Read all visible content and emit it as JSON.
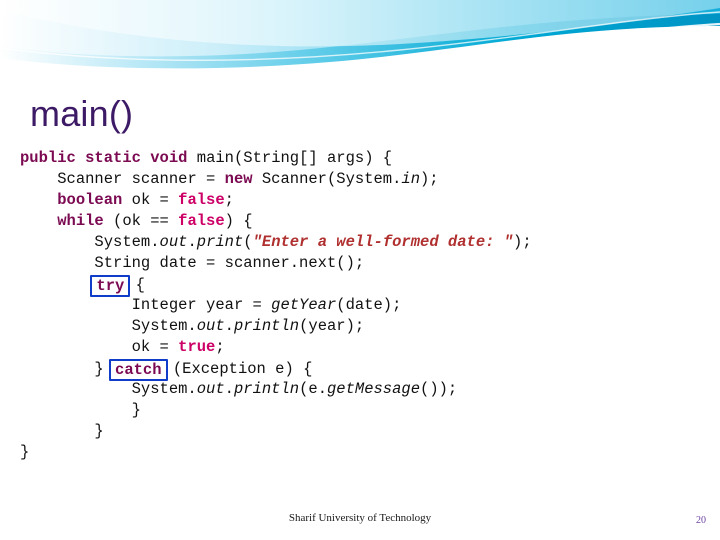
{
  "slide": {
    "title": "main()",
    "footer": "Sharif University of Technology",
    "page_number": "20",
    "accent_color": "#3d1a66",
    "banner_colors": [
      "#00b0d8",
      "#7ad8ef",
      "#c9eff9",
      "#ffffff"
    ]
  },
  "code": {
    "lines": [
      {
        "indent": 0,
        "tokens": [
          {
            "t": "public",
            "c": "kw"
          },
          {
            "t": " ",
            "c": "plain"
          },
          {
            "t": "static",
            "c": "kw"
          },
          {
            "t": " ",
            "c": "plain"
          },
          {
            "t": "void",
            "c": "kw"
          },
          {
            "t": " ",
            "c": "plain"
          },
          {
            "t": "main(String[] args) {",
            "c": "plain"
          }
        ]
      },
      {
        "indent": 1,
        "tokens": [
          {
            "t": "Scanner scanner = ",
            "c": "plain"
          },
          {
            "t": "new",
            "c": "kw"
          },
          {
            "t": " Scanner(System.",
            "c": "plain"
          },
          {
            "t": "in",
            "c": "ital"
          },
          {
            "t": ");",
            "c": "plain"
          }
        ]
      },
      {
        "indent": 1,
        "tokens": [
          {
            "t": "boolean",
            "c": "kw"
          },
          {
            "t": " ok = ",
            "c": "plain"
          },
          {
            "t": "false",
            "c": "kw2"
          },
          {
            "t": ";",
            "c": "plain"
          }
        ]
      },
      {
        "indent": 1,
        "tokens": [
          {
            "t": "while",
            "c": "kw"
          },
          {
            "t": " (ok == ",
            "c": "plain"
          },
          {
            "t": "false",
            "c": "kw2"
          },
          {
            "t": ") {",
            "c": "plain"
          }
        ]
      },
      {
        "indent": 2,
        "tokens": [
          {
            "t": "System.",
            "c": "plain"
          },
          {
            "t": "out",
            "c": "ital"
          },
          {
            "t": ".",
            "c": "plain"
          },
          {
            "t": "print",
            "c": "meth"
          },
          {
            "t": "(",
            "c": "plain"
          },
          {
            "t": "\"Enter a well-formed date: \"",
            "c": "str"
          },
          {
            "t": ");",
            "c": "plain"
          }
        ]
      },
      {
        "indent": 2,
        "tokens": [
          {
            "t": "String date = scanner.next();",
            "c": "plain"
          }
        ]
      },
      {
        "indent": 2,
        "tokens": [
          {
            "t": "try",
            "c": "boxed-kw"
          },
          {
            "t": " {",
            "c": "plain"
          }
        ]
      },
      {
        "indent": 3,
        "tokens": [
          {
            "t": "Integer year = ",
            "c": "plain"
          },
          {
            "t": "getYear",
            "c": "meth"
          },
          {
            "t": "(date);",
            "c": "plain"
          }
        ]
      },
      {
        "indent": 3,
        "tokens": [
          {
            "t": "System.",
            "c": "plain"
          },
          {
            "t": "out",
            "c": "ital"
          },
          {
            "t": ".",
            "c": "plain"
          },
          {
            "t": "println",
            "c": "meth"
          },
          {
            "t": "(year);",
            "c": "plain"
          }
        ]
      },
      {
        "indent": 3,
        "tokens": [
          {
            "t": "ok = ",
            "c": "plain"
          },
          {
            "t": "true",
            "c": "kw2"
          },
          {
            "t": ";",
            "c": "plain"
          }
        ]
      },
      {
        "indent": 2,
        "tokens": [
          {
            "t": "} ",
            "c": "plain"
          },
          {
            "t": "catch",
            "c": "boxed-kw"
          },
          {
            "t": " (Exception e) {",
            "c": "plain"
          }
        ]
      },
      {
        "indent": 3,
        "tokens": [
          {
            "t": "System.",
            "c": "plain"
          },
          {
            "t": "out",
            "c": "ital"
          },
          {
            "t": ".",
            "c": "plain"
          },
          {
            "t": "println",
            "c": "meth"
          },
          {
            "t": "(e.",
            "c": "plain"
          },
          {
            "t": "getMessage",
            "c": "meth"
          },
          {
            "t": "());",
            "c": "plain"
          }
        ]
      },
      {
        "indent": 3,
        "tokens": [
          {
            "t": "}",
            "c": "plain"
          }
        ]
      },
      {
        "indent": 2,
        "tokens": [
          {
            "t": "}",
            "c": "plain"
          }
        ]
      },
      {
        "indent": 0,
        "tokens": [
          {
            "t": "}",
            "c": "plain"
          }
        ]
      }
    ]
  }
}
